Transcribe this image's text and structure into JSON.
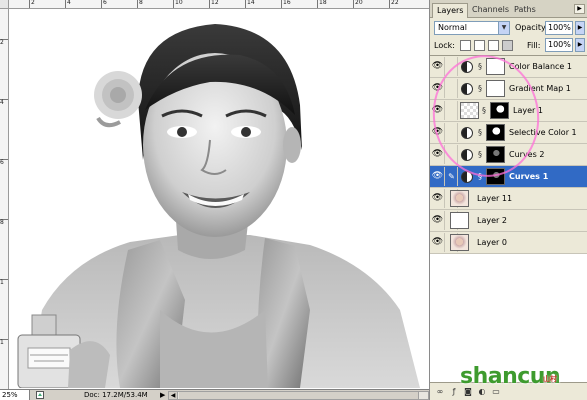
{
  "ruler": {
    "top_labels": [
      "2",
      "4",
      "6",
      "8",
      "10",
      "12",
      "14",
      "16",
      "18",
      "20",
      "22"
    ],
    "left_labels": [
      "2",
      "4",
      "6",
      "8",
      "1",
      "1"
    ]
  },
  "status": {
    "zoom": "25%",
    "doc_size": "Doc: 17.2M/53.4M"
  },
  "panel": {
    "tabs": [
      {
        "label": "Layers",
        "active": true
      },
      {
        "label": "Channels",
        "active": false
      },
      {
        "label": "Paths",
        "active": false
      }
    ],
    "blend_mode": "Normal",
    "opacity_label": "Opacity:",
    "opacity_value": "100%",
    "lock_label": "Lock:",
    "fill_label": "Fill:",
    "fill_value": "100%"
  },
  "layers": [
    {
      "name": "Color Balance 1",
      "type": "adjustment",
      "visible": true,
      "selected": false,
      "mask": "white"
    },
    {
      "name": "Gradient Map 1",
      "type": "adjustment",
      "visible": true,
      "selected": false,
      "mask": "white"
    },
    {
      "name": "Layer 1",
      "type": "pixel",
      "visible": true,
      "selected": false,
      "mask": "figure"
    },
    {
      "name": "Selective Color 1",
      "type": "adjustment",
      "visible": true,
      "selected": false,
      "mask": "figure"
    },
    {
      "name": "Curves 2",
      "type": "adjustment",
      "visible": true,
      "selected": false,
      "mask": "figure-dark"
    },
    {
      "name": "Curves 1",
      "type": "adjustment",
      "visible": true,
      "selected": true,
      "mask": "figure-dark"
    },
    {
      "name": "Layer 11",
      "type": "pixel",
      "visible": true,
      "selected": false,
      "mask": "none"
    },
    {
      "name": "Layer 2",
      "type": "pixel",
      "visible": true,
      "selected": false,
      "mask": "none"
    },
    {
      "name": "Layer 0",
      "type": "pixel",
      "visible": true,
      "selected": false,
      "mask": "none"
    }
  ],
  "watermark": {
    "text": "shancun",
    "sub": "山村"
  }
}
